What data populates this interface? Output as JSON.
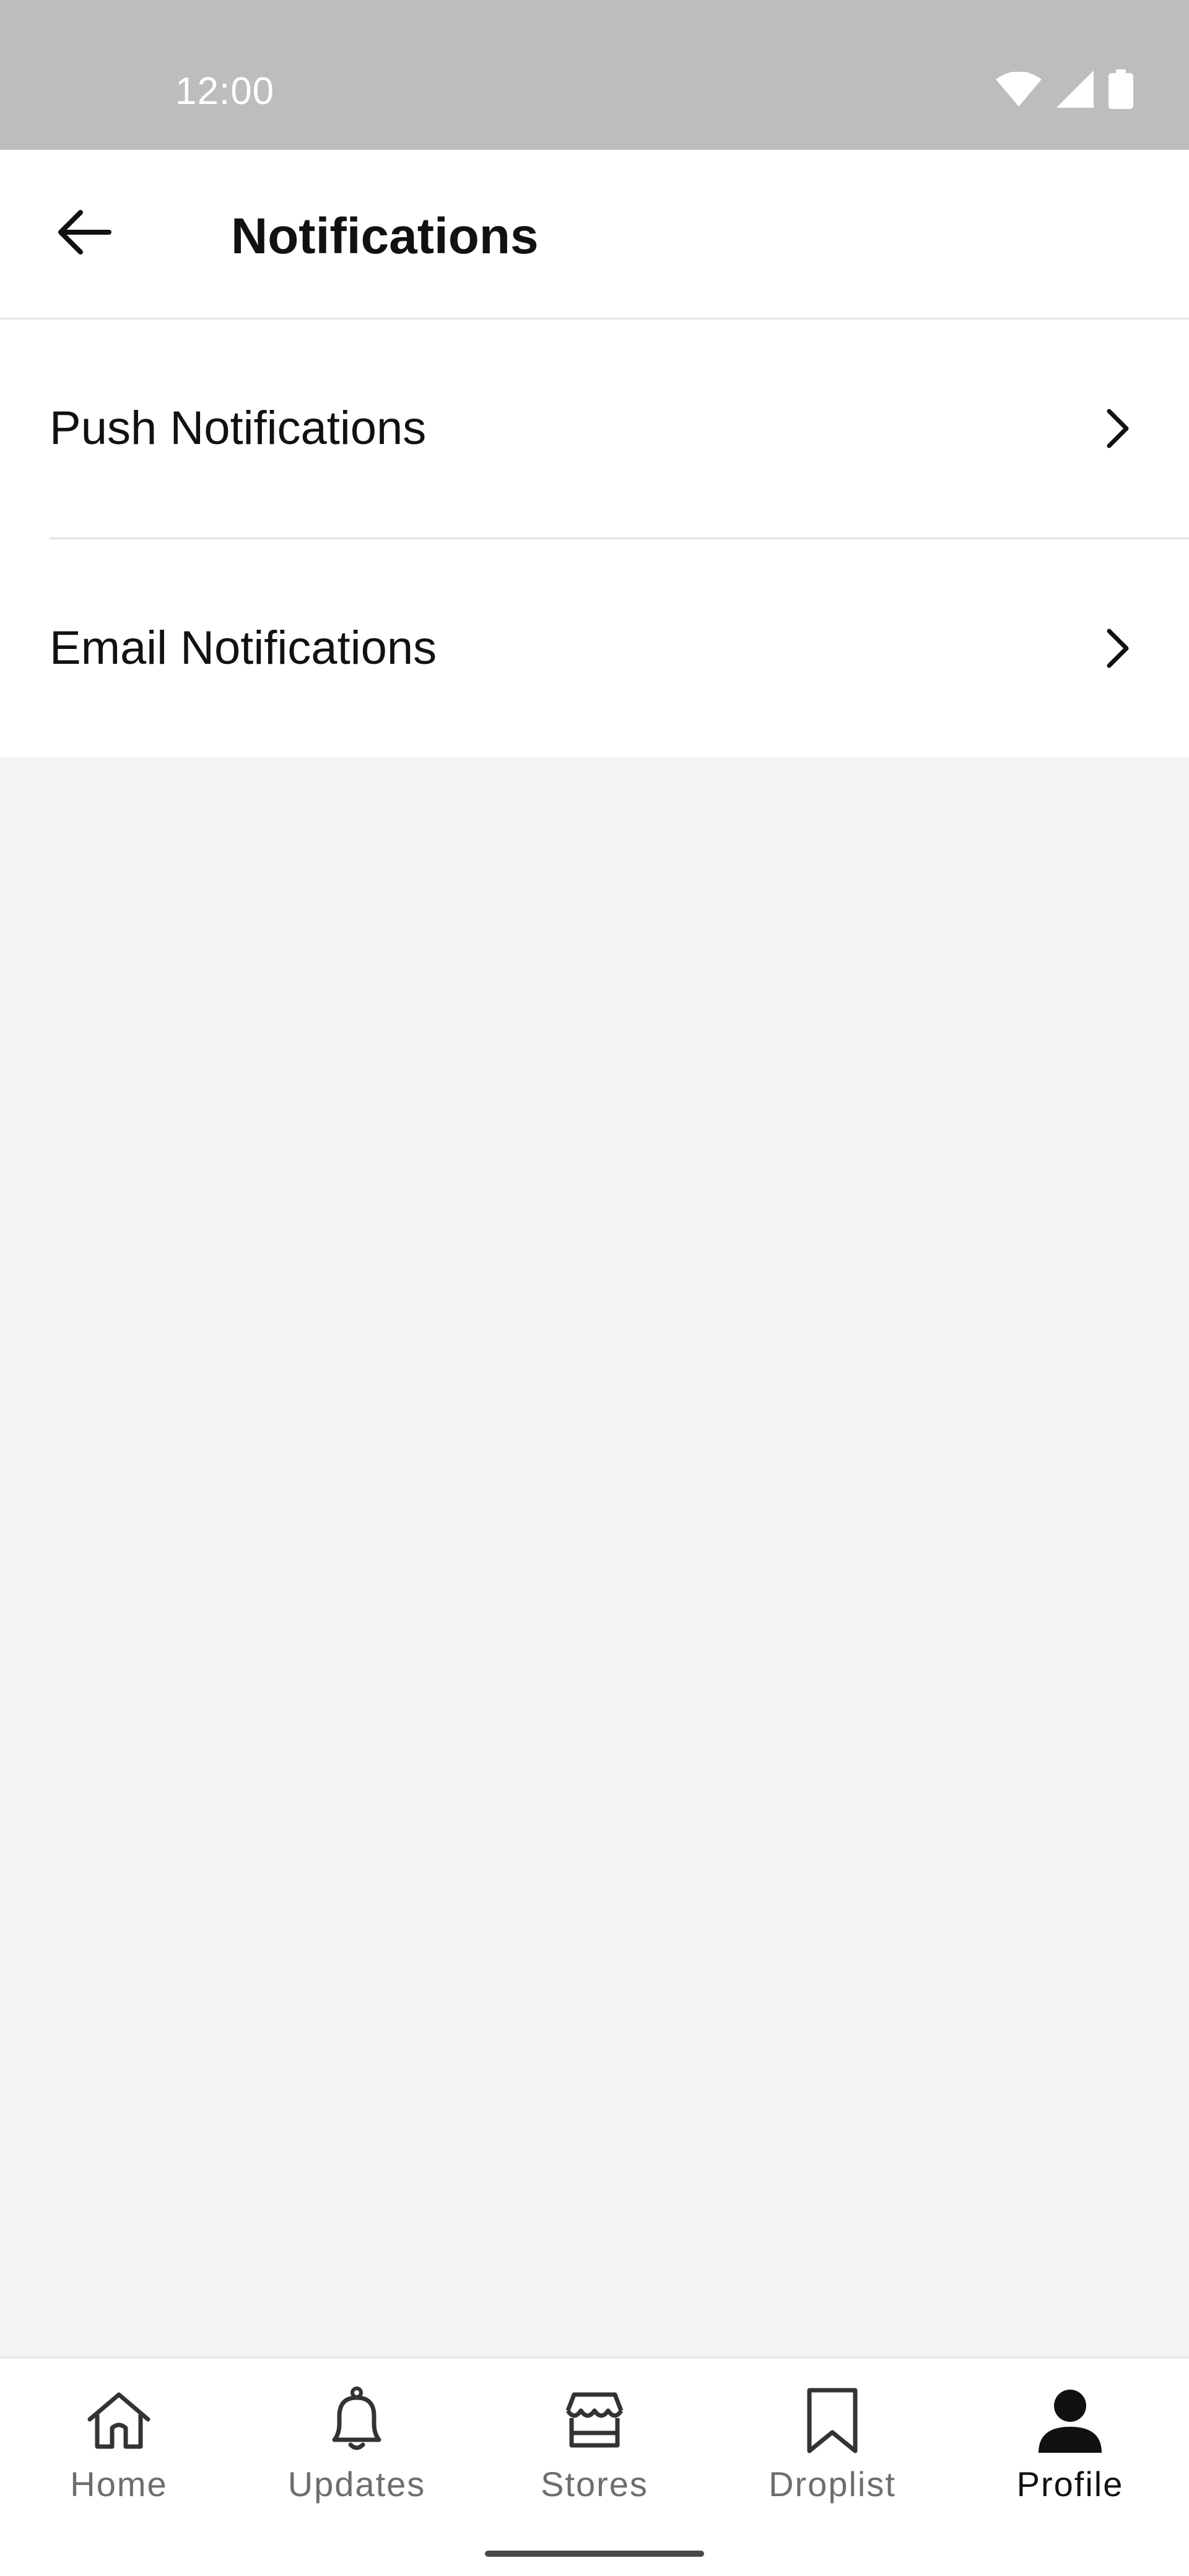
{
  "status_bar": {
    "time": "12:00",
    "icons": [
      "wifi-icon",
      "signal-icon",
      "battery-icon"
    ],
    "background": "#bdbdbd"
  },
  "app_bar": {
    "back_icon": "arrow-left-icon",
    "title": "Notifications"
  },
  "list": {
    "items": [
      {
        "label": "Push Notifications",
        "icon": "chevron-right-icon"
      },
      {
        "label": "Email Notifications",
        "icon": "chevron-right-icon"
      }
    ]
  },
  "bottom_nav": {
    "active": "Profile",
    "items": [
      {
        "label": "Home",
        "icon": "home-icon"
      },
      {
        "label": "Updates",
        "icon": "bell-icon"
      },
      {
        "label": "Stores",
        "icon": "store-icon"
      },
      {
        "label": "Droplist",
        "icon": "bookmark-icon"
      },
      {
        "label": "Profile",
        "icon": "profile-icon"
      }
    ]
  },
  "colors": {
    "text_primary": "#111111",
    "nav_inactive": "#6d6d6d",
    "page_background": "#f3f3f3"
  }
}
